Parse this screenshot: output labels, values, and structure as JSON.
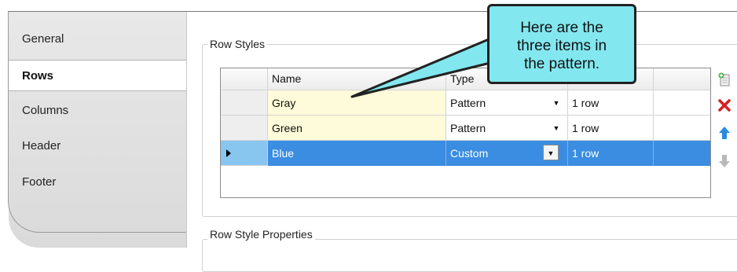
{
  "tabs": {
    "items": [
      {
        "label": "General",
        "active": false
      },
      {
        "label": "Rows",
        "active": true
      },
      {
        "label": "Columns",
        "active": false
      },
      {
        "label": "Header",
        "active": false
      },
      {
        "label": "Footer",
        "active": false
      }
    ]
  },
  "row_styles": {
    "group_title": "Row Styles",
    "columns": [
      "Name",
      "Type",
      ""
    ],
    "rows": [
      {
        "name": "Gray",
        "type": "Pattern",
        "height": "1 row",
        "selected": false
      },
      {
        "name": "Green",
        "type": "Pattern",
        "height": "1 row",
        "selected": false
      },
      {
        "name": "Blue",
        "type": "Custom",
        "height": "1 row",
        "selected": true
      }
    ],
    "dropdown_glyph": "▼"
  },
  "row_style_properties": {
    "group_title": "Row Style Properties"
  },
  "side_buttons": [
    {
      "icon": "new-document-icon"
    },
    {
      "icon": "delete-x-icon"
    },
    {
      "icon": "move-up-arrow-icon"
    },
    {
      "icon": "move-down-arrow-icon"
    }
  ],
  "callout": {
    "lines": [
      "Here are the",
      "three items in",
      "the pattern."
    ]
  },
  "colors": {
    "selection": "#3a8de0",
    "name_cell": "#fdfbd9",
    "callout_fill": "#82e7ef",
    "delete_red": "#d62020",
    "up_arrow_blue": "#2a8ae0"
  }
}
